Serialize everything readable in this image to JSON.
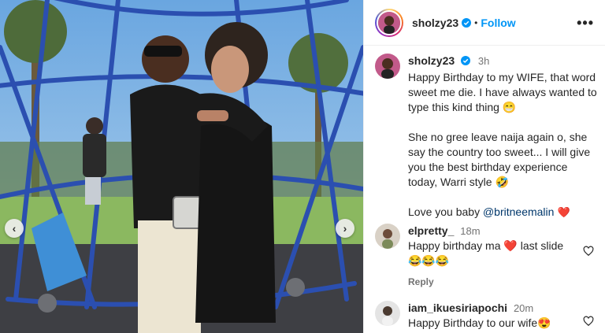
{
  "post": {
    "username": "sholzy23",
    "follow_label": "Follow",
    "separator": "•",
    "more_label": "•••"
  },
  "caption": {
    "username": "sholzy23",
    "time": "3h",
    "line1": "Happy Birthday to my WIFE, that word sweet me die. I have always wanted to type this kind thing 😁",
    "line2": "She no gree leave naija again o, she say the country too sweet... I will give you the best birthday experience today, Warri style 🤣",
    "line3_prefix": "Love you baby ",
    "mention": "@britneemalin",
    "line3_suffix": " ❤️"
  },
  "comments": [
    {
      "username": "elpretty_",
      "time": "18m",
      "text": "Happy birthday ma ❤️ last slide 😂😂😂",
      "reply_label": "Reply"
    },
    {
      "username": "iam_ikuesiriapochi",
      "time": "20m",
      "text": "Happy Birthday to our wife😍"
    }
  ],
  "nav": {
    "prev": "‹",
    "next": "›"
  },
  "colors": {
    "accent": "#0095f6",
    "muted": "#737373",
    "heart_red": "#ed4956"
  }
}
